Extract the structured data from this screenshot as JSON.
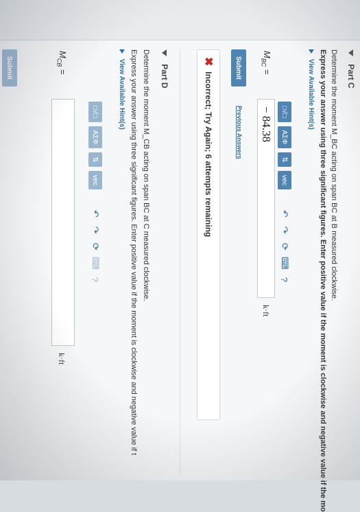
{
  "partC": {
    "title": "Part C",
    "question": "Determine the moment M_BC acting on span BC at B measured clockwise.",
    "instruction": "Express your answer using three significant figures. Enter positive value if the moment is clockwise and negative value if the mo",
    "hints_label": "View Available Hint(s)",
    "answer_label": "M",
    "answer_sub": "BC",
    "answer_value": "− 84.38",
    "unit": "k·ft",
    "submit_label": "Submit",
    "previous_label": "Previous Answers",
    "feedback": "Incorrect; Try Again; 6 attempts remaining"
  },
  "partD": {
    "title": "Part D",
    "question": "Determine the moment M_CB acting on span BC at C measured clockwise.",
    "instruction": "Express your answer using three significant figures. Enter positive value if the moment is clockwise and negative value if t",
    "hints_label": "View Available Hint(s)",
    "answer_label": "M",
    "answer_sub": "CB",
    "answer_value": "",
    "unit": "k·ft",
    "submit_label": "Submit"
  },
  "toolbar": {
    "templates": "□√□",
    "greek": "AΣΦ",
    "arrows": "⇅",
    "vec": "vec",
    "icons": [
      "undo-icon",
      "redo-icon",
      "reset-icon",
      "keyboard-icon",
      "help-icon"
    ]
  }
}
